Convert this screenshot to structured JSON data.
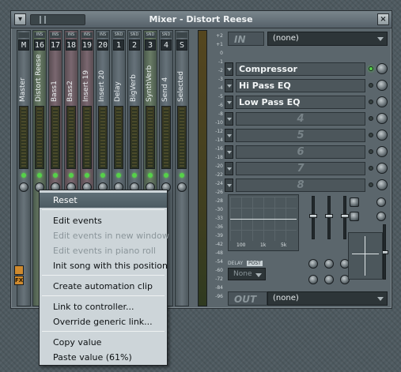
{
  "window": {
    "title": "Mixer - Distort Reese",
    "close_label": "×",
    "menu_label": "▾"
  },
  "strips": [
    {
      "tag": "",
      "num": "M",
      "name": "Master",
      "kind": "master"
    },
    {
      "tag": "INS",
      "num": "16",
      "name": "Distort Reese",
      "kind": "sel"
    },
    {
      "tag": "INS",
      "num": "17",
      "name": "Bass1",
      "kind": "ins"
    },
    {
      "tag": "INS",
      "num": "18",
      "name": "Bass2",
      "kind": "ins"
    },
    {
      "tag": "INS",
      "num": "19",
      "name": "Insert 19",
      "kind": "ins"
    },
    {
      "tag": "INS",
      "num": "20",
      "name": "Insert 20",
      "kind": ""
    },
    {
      "tag": "SND",
      "num": "1",
      "name": "Delay",
      "kind": ""
    },
    {
      "tag": "SND",
      "num": "2",
      "name": "BigVerb",
      "kind": ""
    },
    {
      "tag": "SND",
      "num": "3",
      "name": "SynthVerb",
      "kind": "sel"
    },
    {
      "tag": "SND",
      "num": "4",
      "name": "Send 4",
      "kind": ""
    },
    {
      "tag": "",
      "num": "S",
      "name": "Selected",
      "kind": "master"
    }
  ],
  "scale": [
    "+2",
    "+1",
    "0",
    "-1",
    "-2",
    "-3",
    "-4",
    "-5",
    "-6",
    "-8",
    "-10",
    "-12",
    "-14",
    "-16",
    "-18",
    "-20",
    "-22",
    "-24",
    "-26",
    "-28",
    "-30",
    "-33",
    "-36",
    "-39",
    "-42",
    "-48",
    "-54",
    "-60",
    "-72",
    "-84",
    "-96"
  ],
  "input": {
    "label": "IN",
    "value": "(none)"
  },
  "output": {
    "label": "OUT",
    "value": "(none)"
  },
  "slots": [
    {
      "label": "Compressor",
      "active": true
    },
    {
      "label": "Hi Pass EQ",
      "active": false
    },
    {
      "label": "Low Pass EQ",
      "active": false
    },
    {
      "label": "4",
      "active": false
    },
    {
      "label": "5",
      "active": false
    },
    {
      "label": "6",
      "active": false
    },
    {
      "label": "7",
      "active": false
    },
    {
      "label": "8",
      "active": false
    }
  ],
  "eq": {
    "ticks": [
      "100",
      "1k",
      "5k"
    ]
  },
  "delay": {
    "label": "DELAY",
    "post_label": "POST",
    "value": "None"
  },
  "context_menu": {
    "reset": "Reset",
    "edit_events": "Edit events",
    "edit_new_window": "Edit events in new window",
    "edit_piano_roll": "Edit events in piano roll",
    "init_song": "Init song with this position",
    "automation": "Create automation clip",
    "link_controller": "Link to controller...",
    "override_link": "Override generic link...",
    "copy_value": "Copy value",
    "paste_value": "Paste value (61%)"
  }
}
